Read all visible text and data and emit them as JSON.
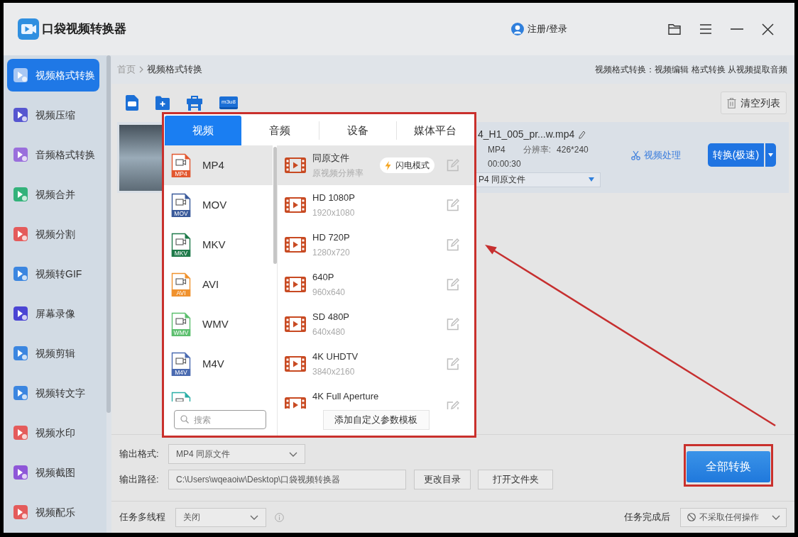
{
  "app": {
    "title": "口袋视频转换器",
    "login": "注册/登录"
  },
  "sidebar": {
    "items": [
      {
        "label": "视频格式转换",
        "selected": true,
        "color": "#a9c8f4"
      },
      {
        "label": "视频压缩",
        "selected": false,
        "color": "#5656d0"
      },
      {
        "label": "音频格式转换",
        "selected": false,
        "color": "#9a6fdc"
      },
      {
        "label": "视频合并",
        "selected": false,
        "color": "#33b27a"
      },
      {
        "label": "视频分割",
        "selected": false,
        "color": "#e45b5b"
      },
      {
        "label": "视频转GIF",
        "selected": false,
        "color": "#3b86e0"
      },
      {
        "label": "屏幕录像",
        "selected": false,
        "color": "#4b45d4"
      },
      {
        "label": "视频剪辑",
        "selected": false,
        "color": "#3b86e0"
      },
      {
        "label": "视频转文字",
        "selected": false,
        "color": "#3b86e0"
      },
      {
        "label": "视频水印",
        "selected": false,
        "color": "#e45b5b"
      },
      {
        "label": "视频截图",
        "selected": false,
        "color": "#8e56d8"
      },
      {
        "label": "视频配乐",
        "selected": false,
        "color": "#e45b5b"
      }
    ]
  },
  "breadcrumb": [
    {
      "label": "首页",
      "current": false
    },
    {
      "label": "视频格式转换",
      "current": true
    }
  ],
  "page_note": "视频格式转换：视频编辑 格式转换 从视频提取音频",
  "toolbar": {
    "tools": [
      {
        "kind": "file"
      },
      {
        "kind": "folder"
      },
      {
        "kind": "toolbox"
      },
      {
        "kind": "m3u8",
        "label": "m3u8"
      }
    ],
    "clear_button": "清空列表"
  },
  "file": {
    "name": "4_H1_005_pr...w.mp4",
    "format": "MP4",
    "resolution_label": "分辨率:",
    "resolution": "426*240",
    "duration": "00:00:30",
    "output": "P4 同原文件",
    "process_button": "视频处理",
    "convert_button": "转换(极速)"
  },
  "format_popup": {
    "highlighted": true,
    "tabs": [
      {
        "label": "视频",
        "selected": true
      },
      {
        "label": "音频",
        "selected": false
      },
      {
        "label": "设备",
        "selected": false
      },
      {
        "label": "媒体平台",
        "selected": false
      }
    ],
    "formats": [
      {
        "label": "MP4",
        "badge": "MP4",
        "color": "#e2572f",
        "selected": true,
        "clipped": false
      },
      {
        "label": "MOV",
        "badge": "MOV",
        "color": "#3a5a9a",
        "selected": false,
        "clipped": false
      },
      {
        "label": "MKV",
        "badge": "MKV",
        "color": "#1f7a4a",
        "selected": false,
        "clipped": false
      },
      {
        "label": "AVI",
        "badge": "AVI",
        "color": "#f0922e",
        "selected": false,
        "clipped": false
      },
      {
        "label": "WMV",
        "badge": "WMV",
        "color": "#5cbf6e",
        "selected": false,
        "clipped": false
      },
      {
        "label": "M4V",
        "badge": "M4V",
        "color": "#4a6ab0",
        "selected": false,
        "clipped": false
      },
      {
        "color": "#2aaea6",
        "selected": false,
        "clipped": true
      }
    ],
    "presets": [
      {
        "title": "同原文件",
        "subtitle": "原视频分辨率",
        "flash_mode": "闪电模式",
        "selected": true,
        "clipped": false
      },
      {
        "title": "HD 1080P",
        "subtitle": "1920x1080",
        "selected": false,
        "clipped": false
      },
      {
        "title": "HD 720P",
        "subtitle": "1280x720",
        "selected": false,
        "clipped": false
      },
      {
        "title": "640P",
        "subtitle": "960x640",
        "selected": false,
        "clipped": false
      },
      {
        "title": "SD 480P",
        "subtitle": "640x480",
        "selected": false,
        "clipped": false
      },
      {
        "title": "4K UHDTV",
        "subtitle": "3840x2160",
        "selected": false,
        "clipped": false
      },
      {
        "title": "4K Full Aperture",
        "selected": false,
        "clipped": true
      }
    ],
    "search": {
      "placeholder": "搜索"
    },
    "add_template_button": "添加自定义参数模板"
  },
  "output": {
    "format": {
      "label": "输出格式:",
      "value": "MP4 同原文件"
    },
    "path": {
      "label": "输出路径:",
      "value": "C:\\Users\\wqeaoiw\\Desktop\\口袋视频转换器"
    },
    "buttons": [
      "更改目录",
      "打开文件夹"
    ],
    "convert_all": {
      "label": "全部转换",
      "highlighted": true
    }
  },
  "footer": {
    "threads": {
      "label": "任务多线程",
      "value": "关闭"
    },
    "after_done": {
      "label": "任务完成后",
      "value": "不采取任何操作"
    }
  },
  "annotations": [
    {
      "kind": "arrow"
    }
  ]
}
